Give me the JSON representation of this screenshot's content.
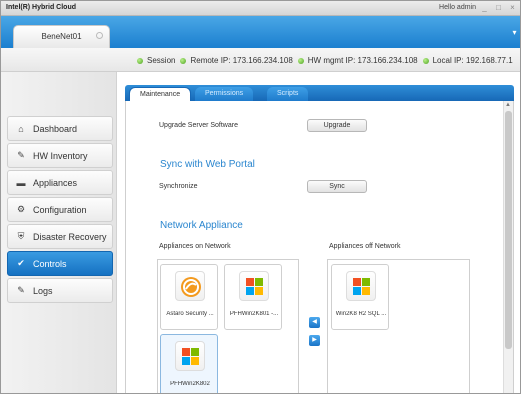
{
  "window": {
    "title": "Intel(R) Hybrid Cloud",
    "greeting": "Hello admin"
  },
  "site_tab": {
    "label": "BeneNet01"
  },
  "status": {
    "session": "Session",
    "remote_ip": "Remote IP: 173.166.234.108",
    "hw_mgmt_ip": "HW mgmt IP: 173.166.234.108",
    "local_ip": "Local IP: 192.168.77.1"
  },
  "sidebar": {
    "items": [
      {
        "label": "Dashboard",
        "icon": "home-icon"
      },
      {
        "label": "HW Inventory",
        "icon": "inventory-icon"
      },
      {
        "label": "Appliances",
        "icon": "appliance-icon"
      },
      {
        "label": "Configuration",
        "icon": "gear-icon"
      },
      {
        "label": "Disaster Recovery",
        "icon": "shield-icon"
      },
      {
        "label": "Controls",
        "icon": "controls-icon"
      },
      {
        "label": "Logs",
        "icon": "log-icon"
      }
    ],
    "active": "Controls"
  },
  "tabs": [
    {
      "label": "Maintenance"
    },
    {
      "label": "Permissions"
    },
    {
      "label": "Scripts"
    }
  ],
  "maintenance": {
    "upgrade_label": "Upgrade Server Software",
    "upgrade_button": "Upgrade",
    "sync_title": "Sync with Web Portal",
    "sync_label": "Synchronize",
    "sync_button": "Sync",
    "network_title": "Network Appliance",
    "on_network_label": "Appliances on Network",
    "off_network_label": "Appliances off Network",
    "on_network": [
      {
        "name": "Astaro Security ...",
        "icon": "astaro-icon"
      },
      {
        "name": "PFHWin2K801 -...",
        "icon": "windows-icon"
      },
      {
        "name": "PFHWin2K802",
        "icon": "windows-icon"
      }
    ],
    "off_network": [
      {
        "name": "Win2K8 R2 SQL ...",
        "icon": "windows-icon"
      }
    ]
  },
  "colors": {
    "accent": "#1b7fcf",
    "status_ok": "#4ea321",
    "section_title": "#2a86cf"
  }
}
